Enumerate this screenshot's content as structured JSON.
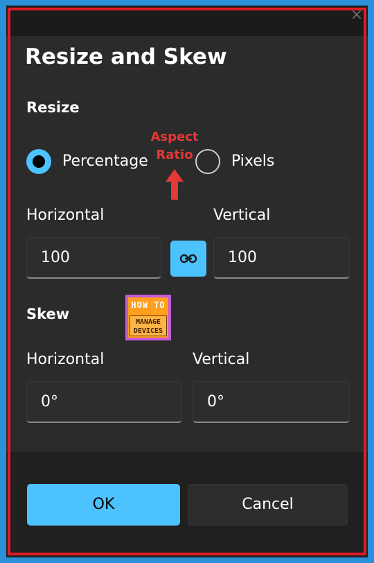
{
  "dialog": {
    "title": "Resize and Skew",
    "close_glyph": "×"
  },
  "resize": {
    "heading": "Resize",
    "options": [
      {
        "label": "Percentage",
        "selected": true
      },
      {
        "label": "Pixels",
        "selected": false
      }
    ],
    "horizontal_label": "Horizontal",
    "vertical_label": "Vertical",
    "horizontal_value": "100",
    "vertical_value": "100",
    "link_icon": "link-icon"
  },
  "annotation": {
    "line1": "Aspect",
    "line2": "Ratio",
    "color": "#e53935"
  },
  "watermark": {
    "top": "HOW TO",
    "line1": "MANAGE",
    "line2": "DEVICES"
  },
  "skew": {
    "heading": "Skew",
    "horizontal_label": "Horizontal",
    "vertical_label": "Vertical",
    "horizontal_value": "0°",
    "vertical_value": "0°"
  },
  "buttons": {
    "ok": "OK",
    "cancel": "Cancel"
  },
  "colors": {
    "accent": "#4cc2ff",
    "outer_frame": "#2c8fd9",
    "highlight_outline": "#e21b24",
    "dialog_bg": "#2b2b2b"
  }
}
